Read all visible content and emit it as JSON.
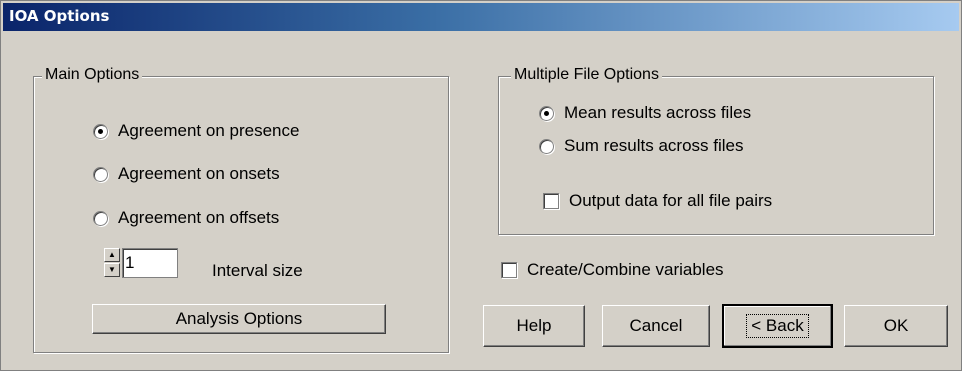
{
  "window": {
    "title": "IOA Options"
  },
  "main_options": {
    "legend": "Main Options",
    "radios": [
      {
        "label": "Agreement on presence",
        "checked": true
      },
      {
        "label": "Agreement on onsets",
        "checked": false
      },
      {
        "label": "Agreement on offsets",
        "checked": false
      }
    ],
    "interval_value": "1",
    "interval_label": "Interval size",
    "analysis_button": "Analysis Options"
  },
  "multiple_file_options": {
    "legend": "Multiple File Options",
    "radios": [
      {
        "label": "Mean results across files",
        "checked": true
      },
      {
        "label": "Sum results across files",
        "checked": false
      }
    ],
    "output_checkbox": {
      "label": "Output data for all file pairs",
      "checked": false
    }
  },
  "create_combine": {
    "label": "Create/Combine variables",
    "checked": false
  },
  "buttons": {
    "help": "Help",
    "cancel": "Cancel",
    "back": "< Back",
    "ok": "OK"
  }
}
